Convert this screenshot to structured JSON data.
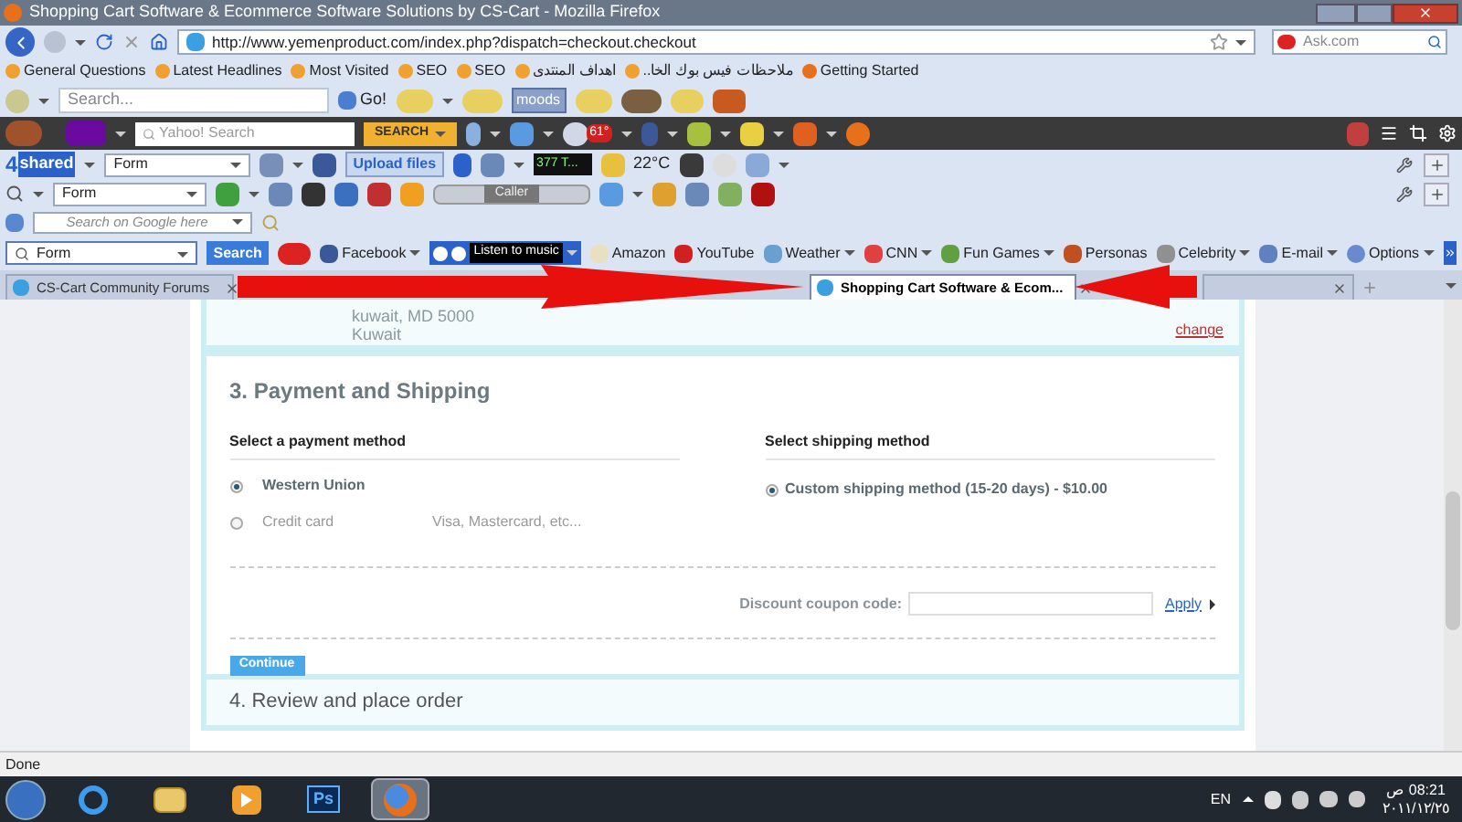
{
  "window": {
    "title": "Shopping Cart Software & Ecommerce Software Solutions by CS-Cart - Mozilla Firefox"
  },
  "nav": {
    "url": "http://www.yemenproduct.com/index.php?dispatch=checkout.checkout",
    "search_placeholder": "Ask.com"
  },
  "bookmarks": [
    "General Questions",
    "Latest Headlines",
    "Most Visited",
    "SEO",
    "SEO",
    "اهداف المنتدى",
    "ملاحظات فيس بوك الخا..",
    "Getting Started"
  ],
  "smiley_bar": {
    "search_placeholder": "Search...",
    "go": "Go!",
    "moods": "moods"
  },
  "yahoo_bar": {
    "search_placeholder": "Yahoo! Search",
    "search_button": "SEARCH",
    "weather_badge": "61°"
  },
  "shared_bar": {
    "logo_number": "4",
    "logo_text": "shared",
    "form_select": "Form",
    "upload": "Upload files",
    "player": "377 T...",
    "temperature": "22°C"
  },
  "form_bar": {
    "form_select": "Form",
    "player_label": "Caller"
  },
  "google_bar": {
    "placeholder": "Search on Google here"
  },
  "links_bar": {
    "form_select": "Form",
    "search_button": "Search",
    "music": "Listen to music",
    "options": "Options",
    "links": [
      {
        "label": "Facebook",
        "dropdown": true
      },
      {
        "label": "Amazon",
        "dropdown": false
      },
      {
        "label": "YouTube",
        "dropdown": false
      },
      {
        "label": "Weather",
        "dropdown": true
      },
      {
        "label": "CNN",
        "dropdown": true
      },
      {
        "label": "Fun Games",
        "dropdown": true
      },
      {
        "label": "Personas",
        "dropdown": false
      },
      {
        "label": "Celebrity",
        "dropdown": true
      },
      {
        "label": "E-mail",
        "dropdown": true
      }
    ]
  },
  "tabs": [
    {
      "title": "CS-Cart Community Forums",
      "selected": false
    },
    {
      "title": "Shopping Cart Software & Ecom...",
      "selected": true
    },
    {
      "selected": false
    }
  ],
  "checkout": {
    "address_lines": [
      "kuwait, MD 5000",
      "Kuwait"
    ],
    "change_link": "change",
    "step3": {
      "title": "3. Payment and Shipping",
      "payment_heading": "Select a payment method",
      "payments": [
        {
          "name": "Western Union",
          "selected": true
        },
        {
          "name": "Credit card",
          "description": "Visa, Mastercard, etc...",
          "selected": false
        }
      ],
      "shipping_heading": "Select shipping method",
      "shipping": [
        {
          "name": "Custom shipping method (15-20 days) - $10.00",
          "selected": true
        }
      ],
      "coupon_label": "Discount coupon code:",
      "apply": "Apply",
      "continue": "Continue"
    },
    "step4": {
      "title": "4. Review and place order"
    }
  },
  "status_bar": {
    "text": "Done"
  },
  "taskbar": {
    "apps": [
      {
        "kind": "ie",
        "selected": false
      },
      {
        "kind": "folder",
        "selected": false
      },
      {
        "kind": "media",
        "selected": false
      },
      {
        "kind": "ps",
        "label": "Ps",
        "selected": false
      },
      {
        "kind": "firefox",
        "selected": true
      }
    ],
    "language": "EN",
    "time": "08:21 ص",
    "date": "٢٠١١/١٢/٢٥"
  }
}
